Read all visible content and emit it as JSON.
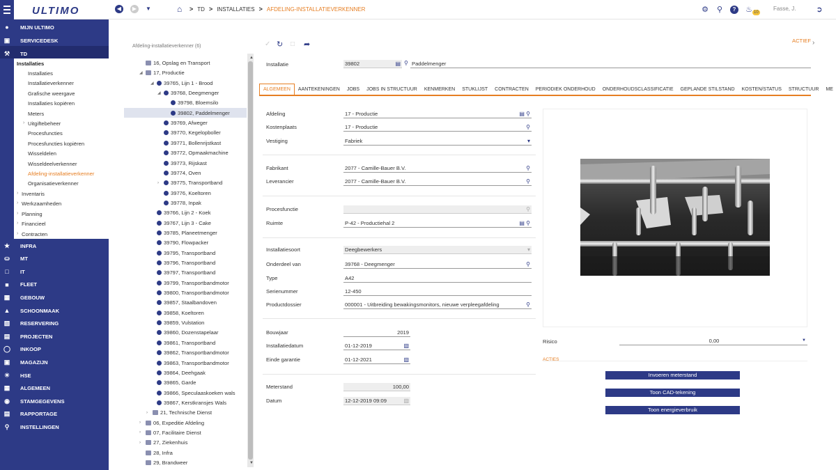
{
  "app": {
    "logo": "ULTIMO",
    "user": "Fasse, J.",
    "notifications": "10"
  },
  "breadcrumb": [
    "TD",
    "INSTALLATIES",
    "AFDELING-INSTALLATIEVERKENNER"
  ],
  "sidebar": {
    "top_items": [
      {
        "label": "MIJN ULTIMO",
        "icon": "person-icon"
      },
      {
        "label": "SERVICEDESK",
        "icon": "chat-icon"
      },
      {
        "label": "TD",
        "icon": "wrench-icon"
      }
    ],
    "td_header": "Installaties",
    "td_sub": [
      "Installaties",
      "Installatieverkenner",
      "Grafische weergave",
      "Installaties kopiëren",
      "Meters",
      "Uitgiftebeheer",
      "Procesfuncties",
      "Procesfuncties kopiëren",
      "Wisseldelen",
      "Wisseldeelverkenner",
      "Afdeling-installatieverkenner",
      "Organisatieverkenner"
    ],
    "td_groups": [
      "Inventaris",
      "Werkzaamheden",
      "Planning",
      "Financieel",
      "Contracten"
    ],
    "bottom_items": [
      {
        "label": "INFRA",
        "icon": "star-icon"
      },
      {
        "label": "MT",
        "icon": "truck-icon"
      },
      {
        "label": "IT",
        "icon": "monitor-icon"
      },
      {
        "label": "FLEET",
        "icon": "car-icon"
      },
      {
        "label": "GEBOUW",
        "icon": "building-icon"
      },
      {
        "label": "SCHOONMAAK",
        "icon": "broom-icon"
      },
      {
        "label": "RESERVERING",
        "icon": "calendar-icon"
      },
      {
        "label": "PROJECTEN",
        "icon": "project-icon"
      },
      {
        "label": "INKOOP",
        "icon": "cart-icon"
      },
      {
        "label": "MAGAZIJN",
        "icon": "warehouse-icon"
      },
      {
        "label": "HSE",
        "icon": "sun-icon"
      },
      {
        "label": "ALGEMEEN",
        "icon": "grid-icon"
      },
      {
        "label": "STAMGEGEVENS",
        "icon": "database-icon"
      },
      {
        "label": "RAPPORTAGE",
        "icon": "report-icon"
      },
      {
        "label": "INSTELLINGEN",
        "icon": "key-icon"
      }
    ]
  },
  "tree": {
    "title": "Afdeling-installatieverkenner (6)",
    "nodes": [
      {
        "label": "16, Opslag en Transport",
        "type": "dept"
      },
      {
        "label": "17, Productie",
        "type": "dept"
      },
      {
        "label": "39765, Lijn 1 - Brood",
        "type": "inst"
      },
      {
        "label": "39768, Deegmenger",
        "type": "inst"
      },
      {
        "label": "39798, Bloemsilo",
        "type": "inst"
      },
      {
        "label": "39802, Paddelmenger",
        "type": "inst"
      },
      {
        "label": "39769, Afweger",
        "type": "inst"
      },
      {
        "label": "39770, Kegelopboller",
        "type": "inst"
      },
      {
        "label": "39771, Bollenrijstkast",
        "type": "inst"
      },
      {
        "label": "39772, Opmaakmachine",
        "type": "inst"
      },
      {
        "label": "39773, Rijskast",
        "type": "inst"
      },
      {
        "label": "39774, Oven",
        "type": "inst"
      },
      {
        "label": "39775, Transportband",
        "type": "inst"
      },
      {
        "label": "39776, Koeltoren",
        "type": "inst"
      },
      {
        "label": "39778, Inpak",
        "type": "inst"
      },
      {
        "label": "39766, Lijn 2 - Koek",
        "type": "inst"
      },
      {
        "label": "39767, Lijn 3 - Cake",
        "type": "inst"
      },
      {
        "label": "39785, Planeetmenger",
        "type": "inst"
      },
      {
        "label": "39790, Flowpacker",
        "type": "inst"
      },
      {
        "label": "39795, Transportband",
        "type": "inst"
      },
      {
        "label": "39796, Transportband",
        "type": "inst"
      },
      {
        "label": "39797, Transportband",
        "type": "inst"
      },
      {
        "label": "39799, Transportbandmotor",
        "type": "inst"
      },
      {
        "label": "39800, Transportbandmotor",
        "type": "inst"
      },
      {
        "label": "39857, Staalbandoven",
        "type": "inst"
      },
      {
        "label": "39858, Koeltoren",
        "type": "inst"
      },
      {
        "label": "39859, Vulstation",
        "type": "inst"
      },
      {
        "label": "39860, Dozenstapelaar",
        "type": "inst"
      },
      {
        "label": "39861, Transportband",
        "type": "inst"
      },
      {
        "label": "39862, Transportbandmotor",
        "type": "inst"
      },
      {
        "label": "39863, Transportbandmotor",
        "type": "inst"
      },
      {
        "label": "39864, Deehgaak",
        "type": "inst"
      },
      {
        "label": "39865, Garde",
        "type": "inst"
      },
      {
        "label": "39866, Speculaaskoeken wals",
        "type": "inst"
      },
      {
        "label": "39867, Kerstkransjes Wals",
        "type": "inst"
      },
      {
        "label": "21, Technische Dienst",
        "type": "dept"
      },
      {
        "label": "06, Expeditie Afdeling",
        "type": "dept"
      },
      {
        "label": "07, Facilitaire Dienst",
        "type": "dept"
      },
      {
        "label": "27, Ziekenhuis",
        "type": "dept"
      },
      {
        "label": "28, Infra",
        "type": "dept"
      },
      {
        "label": "29, Brandweer",
        "type": "dept"
      }
    ]
  },
  "status": "ACTIEF",
  "installatie": {
    "label": "Installatie",
    "code": "39802",
    "name": "Paddelmenger"
  },
  "tabs": [
    "ALGEMEEN",
    "AANTEKENINGEN",
    "JOBS",
    "JOBS IN STRUCTUUR",
    "KENMERKEN",
    "STUKLIJST",
    "CONTRACTEN",
    "PERIODIEK ONDERHOUD",
    "ONDERHOUDSCLASSIFICATIE",
    "GEPLANDE STILSTAND",
    "KOSTEN/STATUS",
    "STRUCTUUR",
    "ME"
  ],
  "form": {
    "afdeling": {
      "label": "Afdeling",
      "value": "17 - Productie"
    },
    "kostenplaats": {
      "label": "Kostenplaats",
      "value": "17 - Productie"
    },
    "vestiging": {
      "label": "Vestiging",
      "value": "Fabriek"
    },
    "fabrikant": {
      "label": "Fabrikant",
      "value": "2077 - Camille-Bauer B.V."
    },
    "leverancier": {
      "label": "Leverancier",
      "value": "2077 - Camille-Bauer B.V."
    },
    "procesfunctie": {
      "label": "Procesfunctie",
      "value": ""
    },
    "ruimte": {
      "label": "Ruimte",
      "value": "P-42 - Productiehal 2"
    },
    "installatiesoort": {
      "label": "Installatiesoort",
      "value": "Deegbewerkers"
    },
    "onderdeel_van": {
      "label": "Onderdeel van",
      "value": "39768 - Deegmenger"
    },
    "type": {
      "label": "Type",
      "value": "A42"
    },
    "serienummer": {
      "label": "Serienummer",
      "value": "12-450"
    },
    "productdossier": {
      "label": "Productdossier",
      "value": "000001 - Uitbreiding bewakingsmonitors, nieuwe verpleegafdeling"
    },
    "bouwjaar": {
      "label": "Bouwjaar",
      "value": "2019"
    },
    "installatiedatum": {
      "label": "Installatiedatum",
      "value": "01-12-2019"
    },
    "einde_garantie": {
      "label": "Einde garantie",
      "value": "01-12-2021"
    },
    "meterstand": {
      "label": "Meterstand",
      "value": "100,00"
    },
    "datum": {
      "label": "Datum",
      "value": "12-12-2019 09:09"
    },
    "risico": {
      "label": "Risico",
      "value": "0,00"
    }
  },
  "acties": {
    "title": "ACTIES",
    "buttons": [
      "Invoeren meterstand",
      "Toon CAD-tekening",
      "Toon energieverbruik"
    ]
  }
}
